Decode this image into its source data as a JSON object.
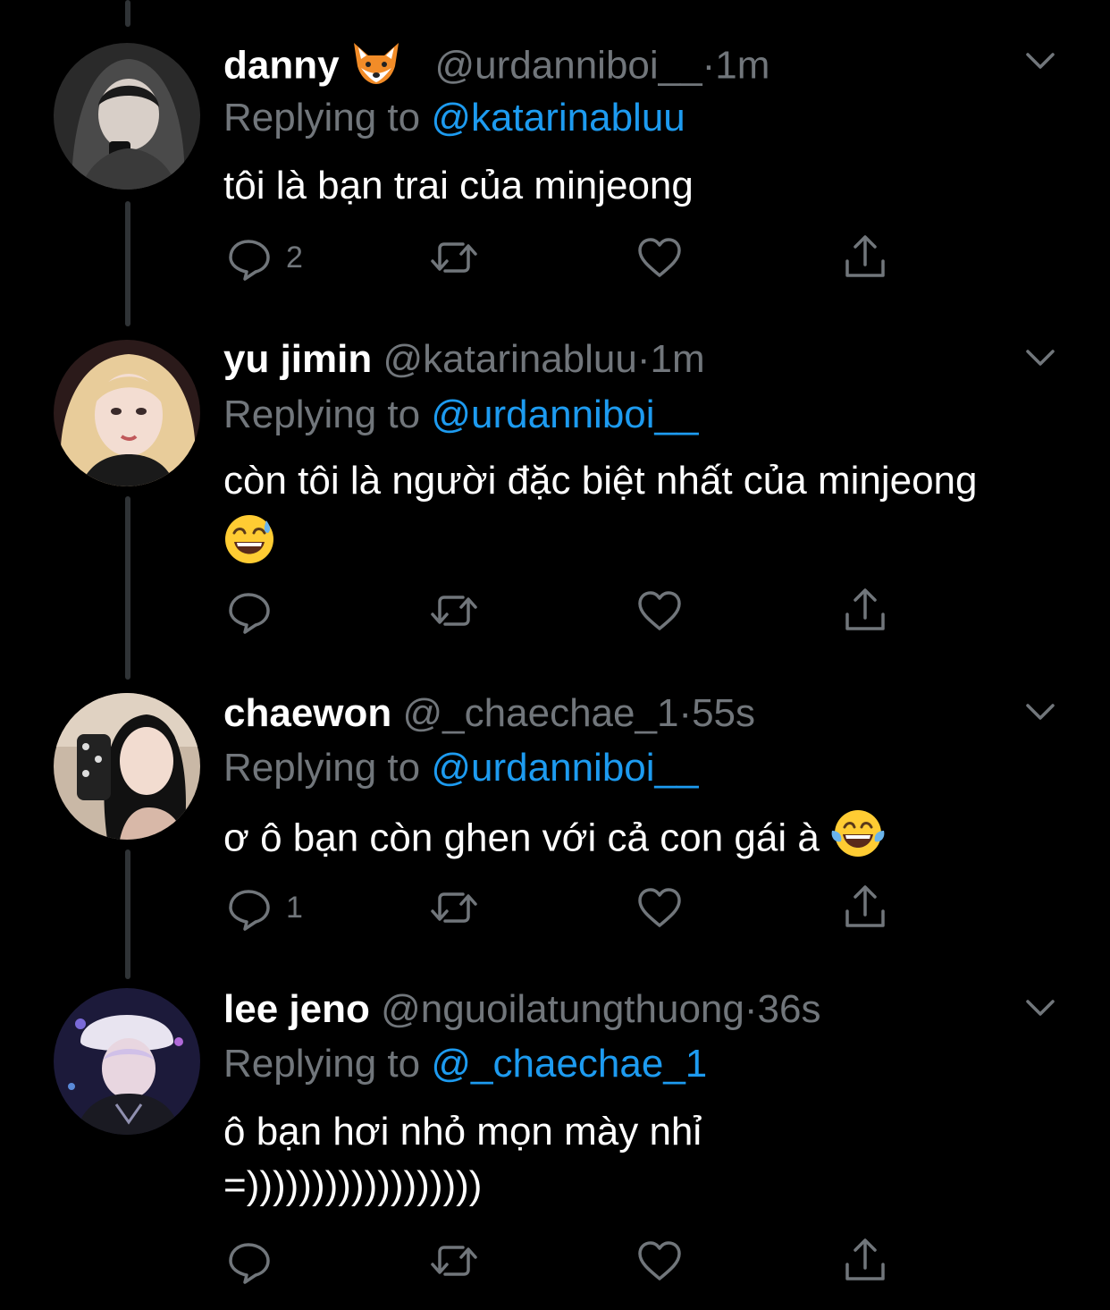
{
  "theme": {
    "background": "#000000",
    "text": "#ffffff",
    "secondary": "#71767b",
    "link": "#1d9bf0",
    "thread_line": "#2f3336"
  },
  "tweets": [
    {
      "name": "danny",
      "name_emoji": "fox-face-emoji",
      "handle": "@urdanniboi__",
      "time": "1m",
      "replying_prefix": "Replying to",
      "replying_to": "@katarinabluu",
      "text_lines": [
        "tôi là bạn trai của minjeong"
      ],
      "reply_count": "2",
      "avatar_icon": "avatar-hooded-person"
    },
    {
      "name": "yu jimin",
      "handle": "@katarinabluu",
      "time": "1m",
      "replying_prefix": "Replying to",
      "replying_to": "@urdanniboi__",
      "text_lines": [
        "còn tôi là người đặc biệt nhất của minjeong"
      ],
      "text_emoji": "sweat-smile-emoji",
      "reply_count": "",
      "avatar_icon": "avatar-blonde-person"
    },
    {
      "name": "chaewon",
      "handle": "@_chaechae_1",
      "time": "55s",
      "replying_prefix": "Replying to",
      "replying_to": "@urdanniboi__",
      "text_lines": [
        "ơ ô bạn còn ghen với cả con gái à"
      ],
      "text_emoji": "tears-of-joy-emoji",
      "reply_count": "1",
      "avatar_icon": "avatar-mirror-selfie"
    },
    {
      "name": "lee jeno",
      "handle": "@nguoilatungthuong",
      "time": "36s",
      "replying_prefix": "Replying to",
      "replying_to": "@_chaechae_1",
      "text_lines": [
        "ô bạn hơi nhỏ mọn mày nhỉ",
        "=))))))))))))))))))"
      ],
      "reply_count": "",
      "avatar_icon": "avatar-fur-hat-person"
    }
  ],
  "separator": "·",
  "icons": {
    "reply": "reply-icon",
    "retweet": "retweet-icon",
    "like": "heart-icon",
    "share": "share-icon",
    "more": "chevron-down-icon"
  }
}
